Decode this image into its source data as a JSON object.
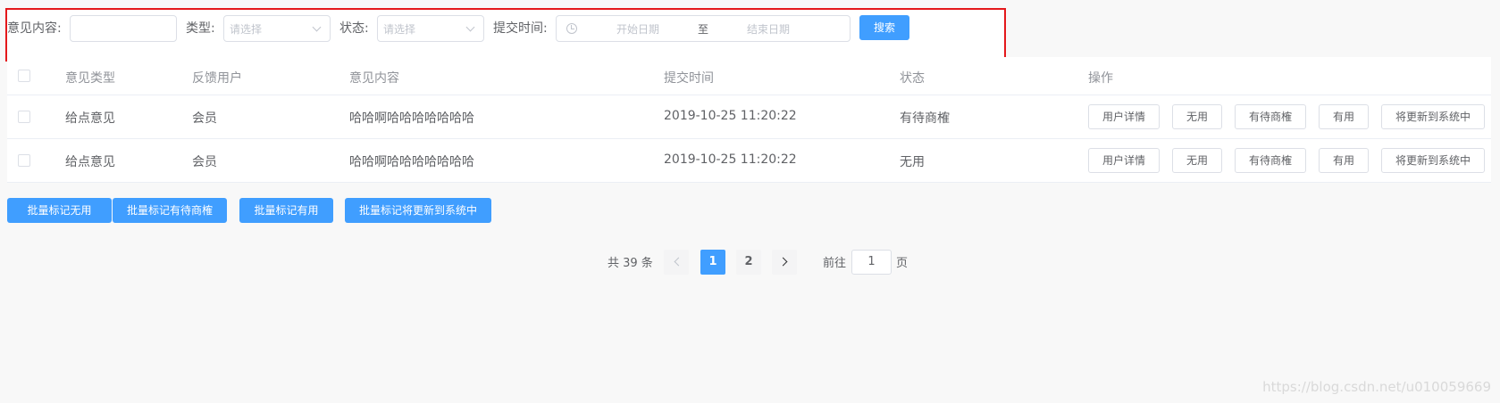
{
  "filters": {
    "content_label": "意见内容:",
    "content_value": "",
    "type_label": "类型:",
    "type_placeholder": "请选择",
    "status_label": "状态:",
    "status_placeholder": "请选择",
    "time_label": "提交时间:",
    "start_placeholder": "开始日期",
    "range_separator": "至",
    "end_placeholder": "结束日期",
    "search_label": "搜索"
  },
  "table": {
    "columns": [
      "意见类型",
      "反馈用户",
      "意见内容",
      "提交时间",
      "状态",
      "操作"
    ],
    "rows": [
      {
        "type": "给点意见",
        "user": "会员",
        "content": "哈哈啊哈哈哈哈哈哈哈",
        "time": "2019-10-25 11:20:22",
        "status": "有待商榷"
      },
      {
        "type": "给点意见",
        "user": "会员",
        "content": "哈哈啊哈哈哈哈哈哈哈",
        "time": "2019-10-25 11:20:22",
        "status": "无用"
      }
    ],
    "actions": [
      "用户详情",
      "无用",
      "有待商榷",
      "有用",
      "将更新到系统中"
    ]
  },
  "batch": [
    "批量标记无用",
    "批量标记有待商榷",
    "批量标记有用",
    "批量标记将更新到系统中"
  ],
  "pagination": {
    "total_text": "共 39 条",
    "pages": [
      "1",
      "2"
    ],
    "current": "1",
    "goto_prefix": "前往",
    "goto_value": "1",
    "goto_suffix": "页"
  },
  "watermark": "https://blog.csdn.net/u010059669",
  "colors": {
    "primary": "#409eff",
    "highlight_border": "#e4181b"
  }
}
